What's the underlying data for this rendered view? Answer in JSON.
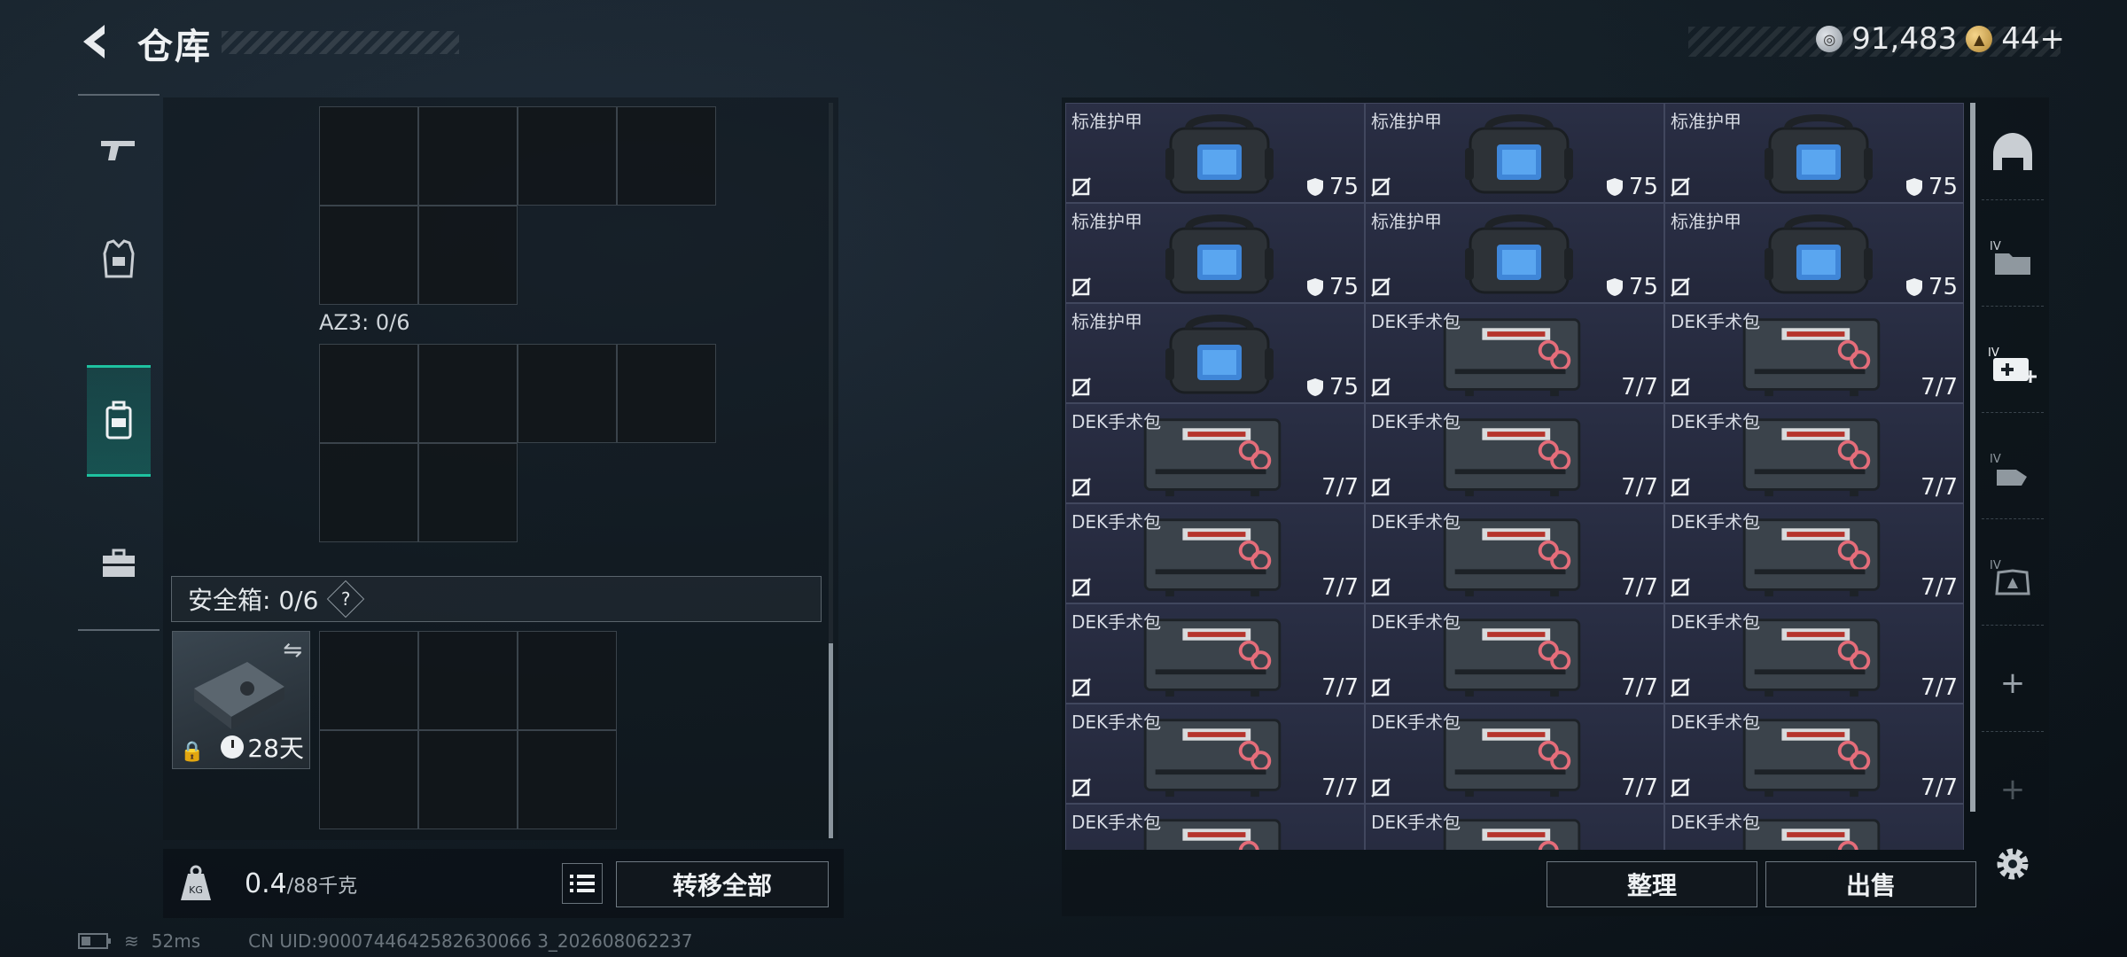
{
  "header": {
    "title": "仓库"
  },
  "currency": {
    "silver": "91,483",
    "gold": "44+"
  },
  "left": {
    "az3_label": "AZ3: 0/6",
    "safe_label": "安全箱: 0/6",
    "help": "?",
    "safebox_days": "28天",
    "weight_value": "0.4",
    "weight_max": "/88千克",
    "transfer_all": "转移全部",
    "kg_icon_text": "KG"
  },
  "status": {
    "ping": "52ms",
    "uid": "CN UID:9000744642582630066 3_202608062237"
  },
  "buttons": {
    "sort": "整理",
    "sell": "出售"
  },
  "inventory": {
    "armor_name": "标准护甲",
    "armor_value": "75",
    "kit_name": "DEK手术包",
    "kit_value": "7/7"
  },
  "colors": {
    "accent": "#1ec2a0",
    "item_bg": "#262a3e"
  }
}
